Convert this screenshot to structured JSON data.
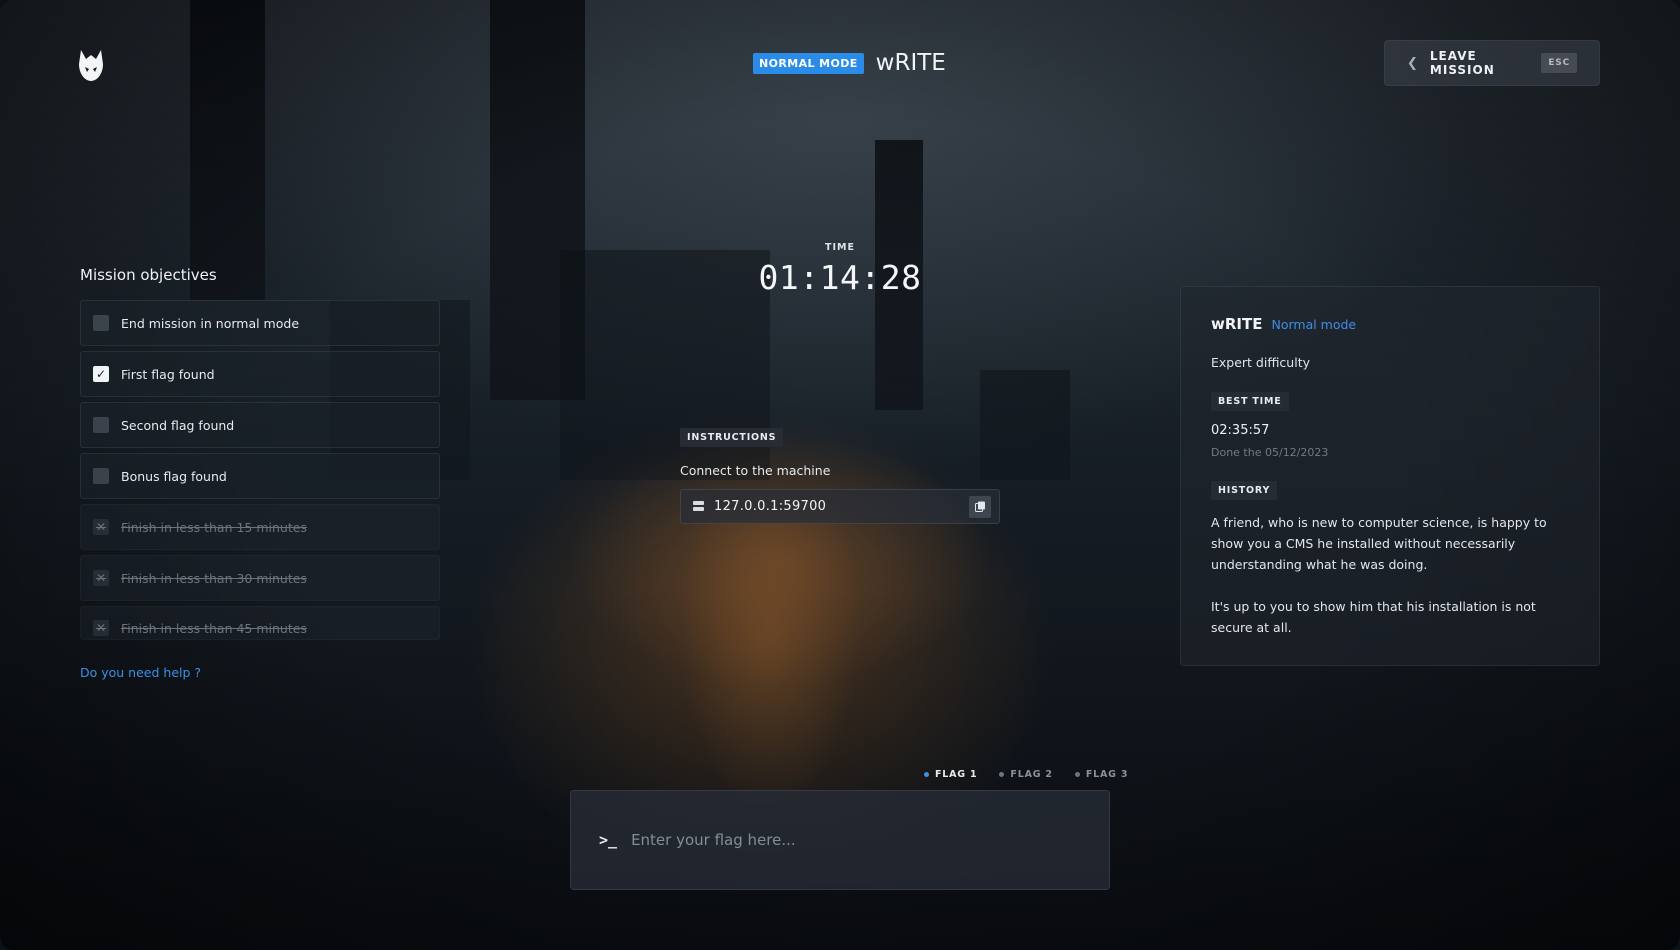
{
  "header": {
    "mode_badge": "NORMAL MODE",
    "mission_title": "wRITE",
    "leave_label": "LEAVE MISSION",
    "leave_shortcut": "ESC"
  },
  "objectives": {
    "title": "Mission objectives",
    "items": [
      {
        "label": "End mission in normal mode",
        "checked": false,
        "state": "open"
      },
      {
        "label": "First flag found",
        "checked": true,
        "state": "open"
      },
      {
        "label": "Second flag found",
        "checked": false,
        "state": "open"
      },
      {
        "label": "Bonus flag found",
        "checked": false,
        "state": "open"
      },
      {
        "label": "Finish in less than 15 minutes",
        "checked": false,
        "state": "failed"
      },
      {
        "label": "Finish in less than 30 minutes",
        "checked": false,
        "state": "failed"
      },
      {
        "label": "Finish in less than 45 minutes",
        "checked": false,
        "state": "failed"
      }
    ],
    "help_link": "Do you need help ?"
  },
  "timer": {
    "label": "TIME",
    "value": "01:14:28"
  },
  "instructions": {
    "tag": "INSTRUCTIONS",
    "text": "Connect to the machine",
    "address": "127.0.0.1:59700",
    "server_icon": "server-icon",
    "copy_icon": "copy-icon"
  },
  "info": {
    "title": "wRITE",
    "mode": "Normal mode",
    "difficulty": "Expert difficulty",
    "best_time_tag": "BEST TIME",
    "best_time": "02:35:57",
    "done_date": "Done the 05/12/2023",
    "history_tag": "HISTORY",
    "history_p1": "A friend, who is new to computer science, is happy to show you a CMS he installed without necessarily understanding what he was doing.",
    "history_p2": "It's up to you to show him that his installation is not secure at all."
  },
  "flags": {
    "tabs": [
      {
        "label": "FLAG 1",
        "active": true
      },
      {
        "label": "FLAG 2",
        "active": false
      },
      {
        "label": "FLAG 3",
        "active": false
      }
    ],
    "input_placeholder": "Enter your flag here...",
    "input_value": ""
  },
  "colors": {
    "accent": "#3d8ee8",
    "badge": "#2a8ce6"
  }
}
